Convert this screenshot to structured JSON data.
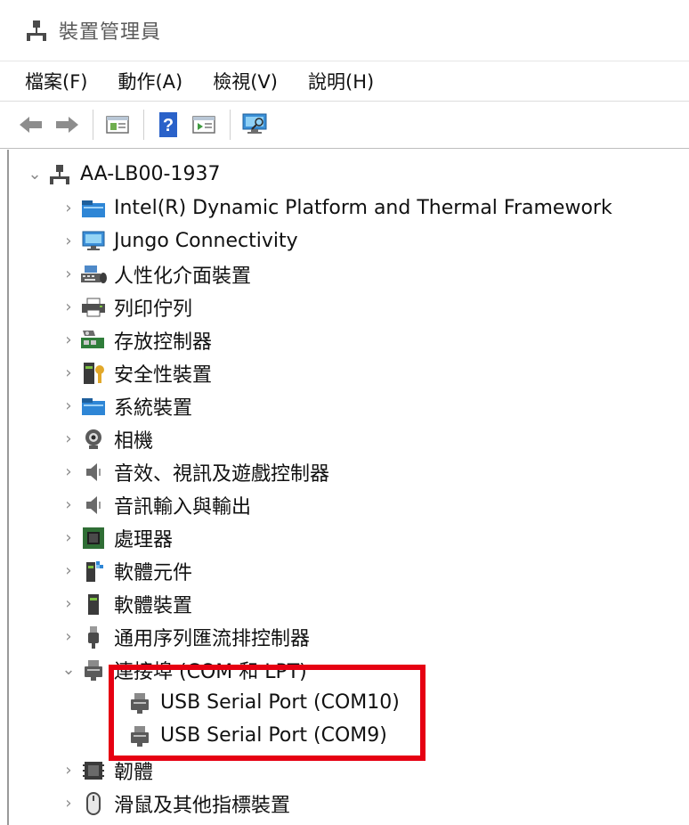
{
  "window": {
    "title": "裝置管理員"
  },
  "menu": [
    "檔案(F)",
    "動作(A)",
    "檢視(V)",
    "說明(H)"
  ],
  "toolbar": [
    "back-icon",
    "forward-icon",
    "properties-icon",
    "help-icon",
    "update-driver-icon",
    "scan-hardware-icon"
  ],
  "tree": {
    "root": "AA-LB00-1937",
    "categories": [
      "Intel(R) Dynamic Platform and Thermal Framework",
      "Jungo Connectivity",
      "人性化介面裝置",
      "列印佇列",
      "存放控制器",
      "安全性裝置",
      "系統裝置",
      "相機",
      "音效、視訊及遊戲控制器",
      "音訊輸入與輸出",
      "處理器",
      "軟體元件",
      "軟體裝置",
      "通用序列匯流排控制器",
      "連接埠 (COM 和 LPT)",
      "韌體",
      "滑鼠及其他指標裝置"
    ],
    "ports": [
      "USB Serial Port (COM10)",
      "USB Serial Port (COM9)"
    ]
  },
  "colors": {
    "highlight": "#e60012",
    "title_text": "#5a5a5a"
  }
}
